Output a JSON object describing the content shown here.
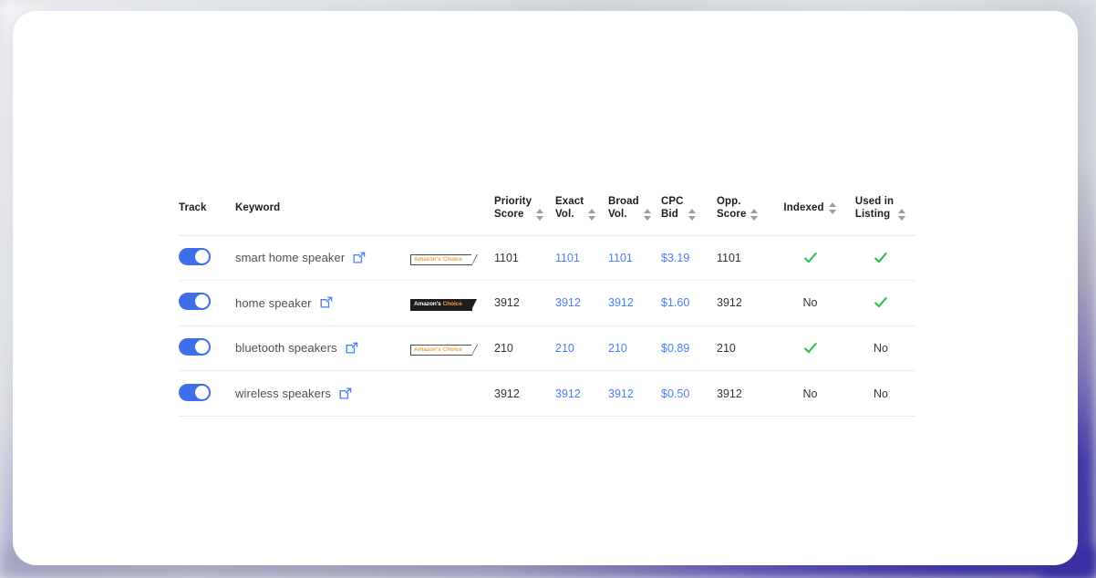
{
  "table": {
    "columns": [
      {
        "key": "track",
        "label": "Track",
        "sortable": false,
        "align": "left"
      },
      {
        "key": "keyword",
        "label": "Keyword",
        "sortable": false,
        "align": "left"
      },
      {
        "key": "badge",
        "label": "",
        "sortable": false,
        "align": "left"
      },
      {
        "key": "priority",
        "label": "Priority\nScore",
        "sortable": true,
        "align": "left"
      },
      {
        "key": "exact",
        "label": "Exact\nVol.",
        "sortable": true,
        "align": "left"
      },
      {
        "key": "broad",
        "label": "Broad\nVol.",
        "sortable": true,
        "align": "left"
      },
      {
        "key": "cpc",
        "label": "CPC\nBid",
        "sortable": true,
        "align": "left"
      },
      {
        "key": "opp",
        "label": "Opp.\nScore",
        "sortable": true,
        "align": "left"
      },
      {
        "key": "indexed",
        "label": "Indexed",
        "sortable": true,
        "align": "center"
      },
      {
        "key": "used",
        "label": "Used in\nListing",
        "sortable": true,
        "align": "center"
      }
    ],
    "rows": [
      {
        "track_on": true,
        "keyword": "smart home speaker",
        "link_icon": "external-link-icon",
        "badge": {
          "show": true,
          "variant": "light",
          "text_1": "Amazon's",
          "text_2": "Choice"
        },
        "priority_score": "1101",
        "exact_vol": "1101",
        "broad_vol": "1101",
        "cpc_bid": "$3.19",
        "opp_score": "1101",
        "indexed": {
          "type": "check",
          "text": ""
        },
        "used_in_listing": {
          "type": "check",
          "text": ""
        }
      },
      {
        "track_on": true,
        "keyword": "home speaker",
        "link_icon": "external-link-icon",
        "badge": {
          "show": true,
          "variant": "dark",
          "text_1": "Amazon's",
          "text_2": "Choice"
        },
        "priority_score": "3912",
        "exact_vol": "3912",
        "broad_vol": "3912",
        "cpc_bid": "$1.60",
        "opp_score": "3912",
        "indexed": {
          "type": "text",
          "text": "No"
        },
        "used_in_listing": {
          "type": "check",
          "text": ""
        }
      },
      {
        "track_on": true,
        "keyword": "bluetooth speakers",
        "link_icon": "external-link-icon",
        "badge": {
          "show": true,
          "variant": "light",
          "text_1": "Amazon's",
          "text_2": "Choice"
        },
        "priority_score": "210",
        "exact_vol": "210",
        "broad_vol": "210",
        "cpc_bid": "$0.89",
        "opp_score": "210",
        "indexed": {
          "type": "check",
          "text": ""
        },
        "used_in_listing": {
          "type": "text",
          "text": "No"
        }
      },
      {
        "track_on": true,
        "keyword": "wireless speakers",
        "link_icon": "external-link-icon",
        "badge": {
          "show": false,
          "variant": "none",
          "text_1": "",
          "text_2": ""
        },
        "priority_score": "3912",
        "exact_vol": "3912",
        "broad_vol": "3912",
        "cpc_bid": "$0.50",
        "opp_score": "3912",
        "indexed": {
          "type": "text",
          "text": "No"
        },
        "used_in_listing": {
          "type": "text",
          "text": "No"
        }
      }
    ]
  },
  "colors": {
    "toggle_on": "#3f6fe8",
    "link_blue": "#4a7bf7",
    "check_green": "#2ec14a",
    "badge_orange": "#f59b36",
    "badge_dark_bg": "#1d1d1d",
    "card_bg": "#ffffff",
    "desktop_accent": "#3f34ab"
  }
}
